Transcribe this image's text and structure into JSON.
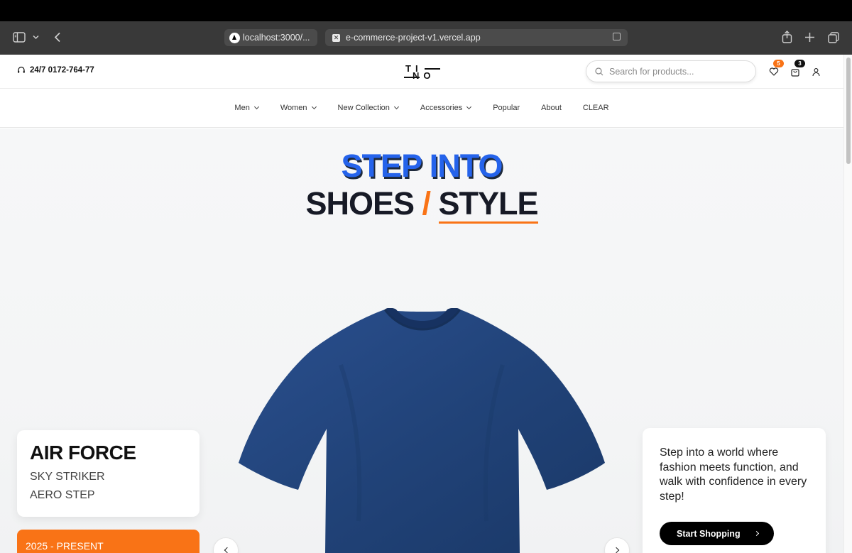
{
  "browser": {
    "tabs": [
      {
        "label": "localhost:3000/..."
      },
      {
        "label": "e-commerce-project-v1.vercel.app"
      }
    ]
  },
  "header": {
    "phone": "24/7 0172-764-77",
    "logo_top": "TI",
    "logo_bottom": "NO",
    "search_placeholder": "Search for products...",
    "wishlist_count": "5",
    "cart_count": "3",
    "wishlist_badge_color": "#f97316",
    "cart_badge_color": "#111111"
  },
  "nav": {
    "items": [
      {
        "label": "Men",
        "dropdown": true
      },
      {
        "label": "Women",
        "dropdown": true
      },
      {
        "label": "New Collection",
        "dropdown": true
      },
      {
        "label": "Accessories",
        "dropdown": true
      },
      {
        "label": "Popular",
        "dropdown": false
      },
      {
        "label": "About",
        "dropdown": false
      },
      {
        "label": "CLEAR",
        "dropdown": false
      }
    ]
  },
  "hero": {
    "line1": "STEP INTO",
    "line2_a": "SHOES",
    "line2_slash": "/",
    "line2_b": "STYLE",
    "accent_blue": "#2563eb",
    "accent_orange": "#f97316",
    "product_image": "navy-tshirt",
    "product_color": "#1f3f78",
    "left_card": {
      "title": "AIR FORCE",
      "line1": "SKY STRIKER",
      "line2": "AERO STEP"
    },
    "date_label": "2025 - PRESENT",
    "right_card": {
      "text": "Step into a world where fashion meets function, and walk with confidence in every step!",
      "cta": "Start Shopping"
    }
  }
}
